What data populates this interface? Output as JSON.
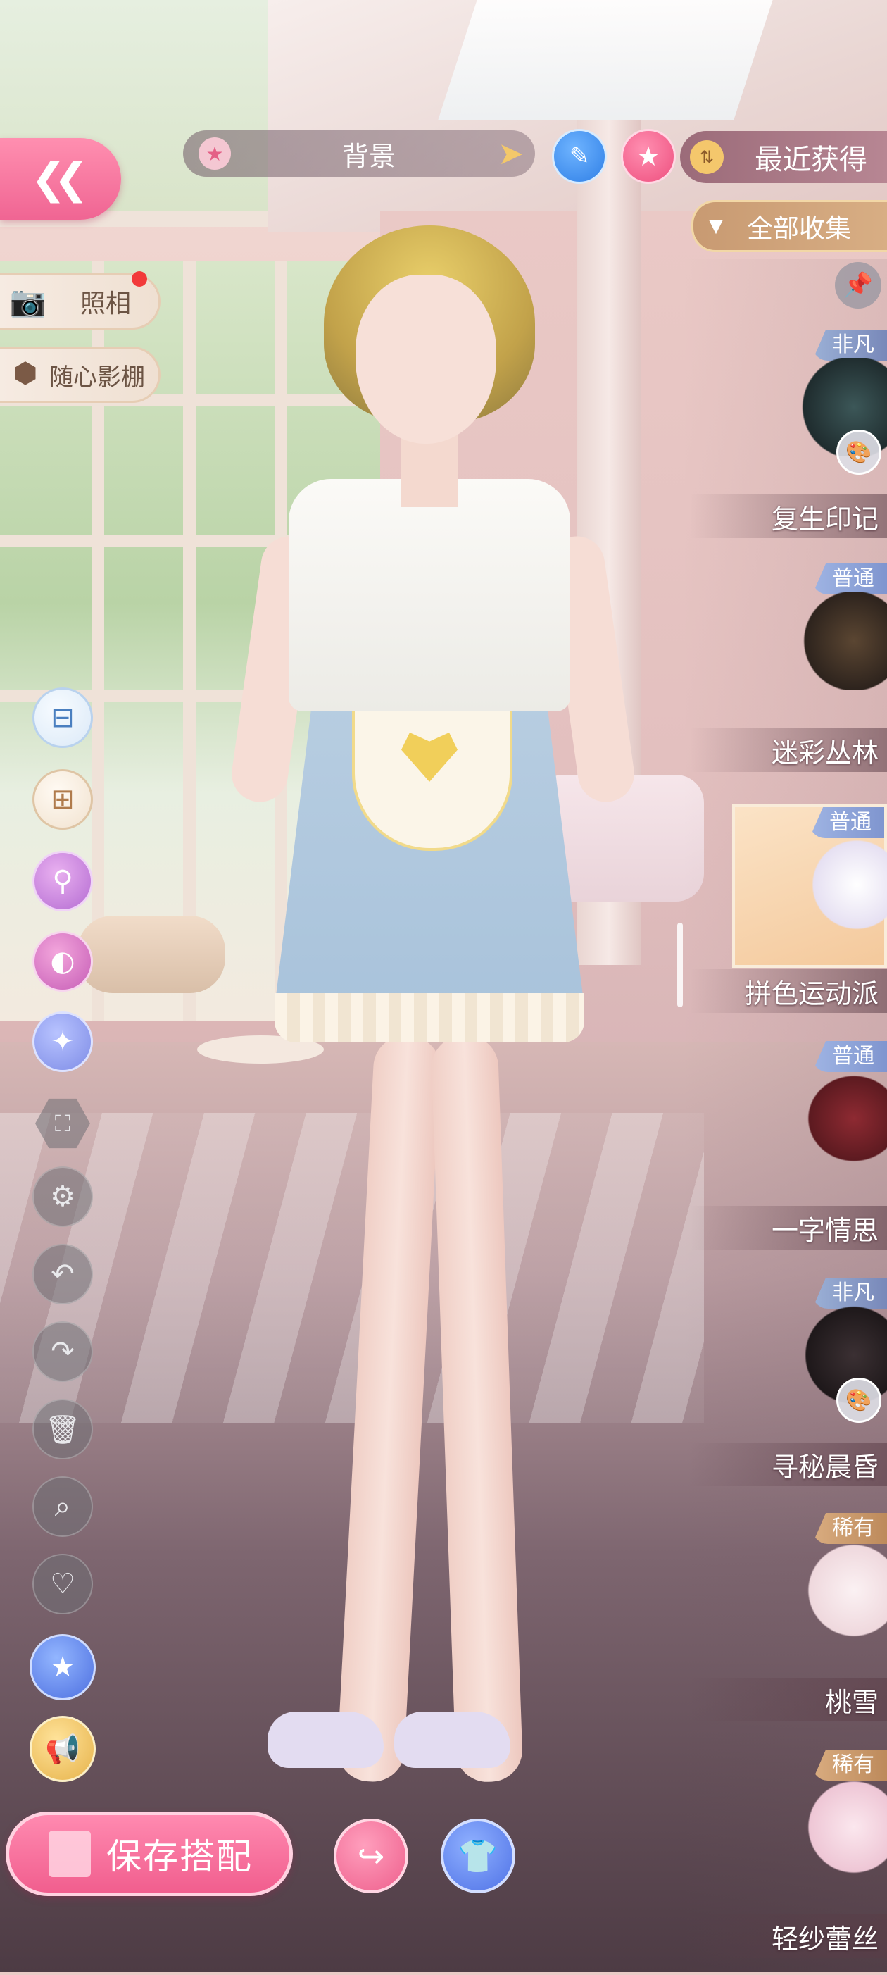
{
  "header": {
    "back_icon": "double-chevron-left-icon",
    "background_label": "背景",
    "sort_label": "最近获得",
    "filter_label": "全部收集"
  },
  "left_panel": {
    "photo_label": "照相",
    "studio_label": "随心影棚"
  },
  "tools": [
    "cup-icon",
    "copy-add-icon",
    "magnifier-swap-icon",
    "palette-icon",
    "sparkle-icon",
    "fullscreen-icon",
    "gear-icon",
    "undo-icon",
    "redo-icon",
    "trash-icon",
    "search-icon",
    "heart-icon",
    "star-badge-icon",
    "megaphone-icon"
  ],
  "bottom": {
    "save_label": "保存搭配"
  },
  "items": [
    {
      "name": "复生印记",
      "rarity": "非凡",
      "has_palette": true,
      "color": "#2a3e3f"
    },
    {
      "name": "迷彩丛林",
      "rarity": "普通",
      "has_palette": false,
      "color": "#3b2f28"
    },
    {
      "name": "拼色运动派",
      "rarity": "普通",
      "has_palette": false,
      "selected": true,
      "color": "#ffffff"
    },
    {
      "name": "一字情思",
      "rarity": "普通",
      "has_palette": false,
      "color": "#7a1f26"
    },
    {
      "name": "寻秘晨昏",
      "rarity": "非凡",
      "has_palette": true,
      "color": "#2b2426"
    },
    {
      "name": "桃雪",
      "rarity": "稀有",
      "has_palette": false,
      "color": "#f6e7ea"
    },
    {
      "name": "轻纱蕾丝",
      "rarity": "稀有",
      "has_palette": false,
      "color": "#f3d8e3"
    }
  ]
}
